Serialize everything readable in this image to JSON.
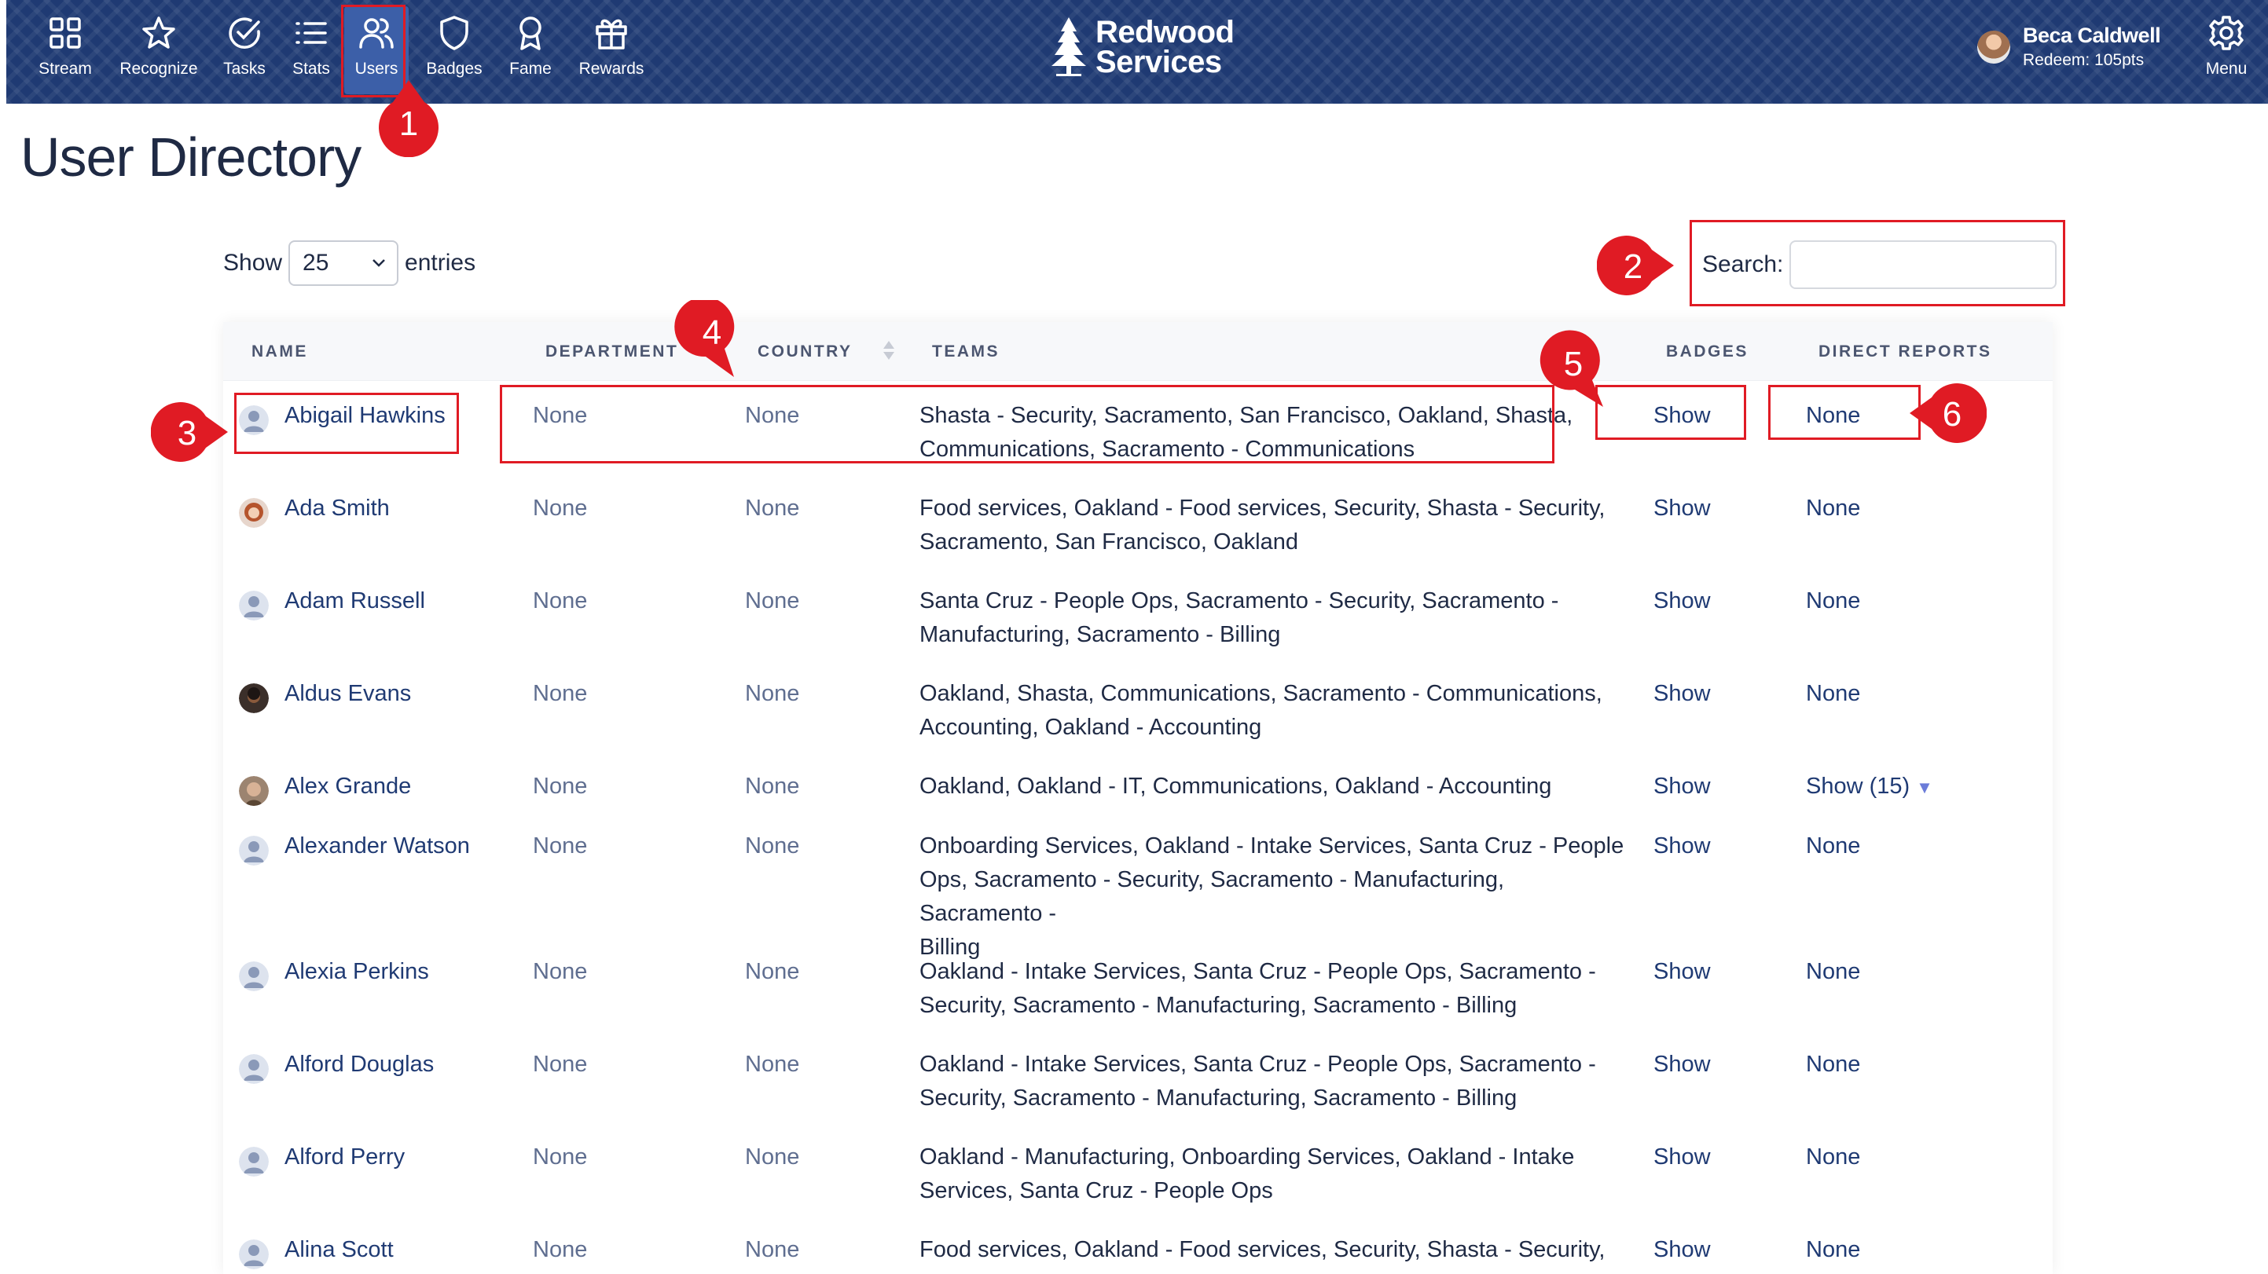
{
  "nav": {
    "items": [
      {
        "label": "Stream",
        "icon": "grid-icon"
      },
      {
        "label": "Recognize",
        "icon": "star-icon"
      },
      {
        "label": "Tasks",
        "icon": "check-circle-icon"
      },
      {
        "label": "Stats",
        "icon": "list-icon"
      },
      {
        "label": "Users",
        "icon": "users-icon",
        "active": true
      },
      {
        "label": "Badges",
        "icon": "shield-icon"
      },
      {
        "label": "Fame",
        "icon": "award-icon"
      },
      {
        "label": "Rewards",
        "icon": "gift-icon"
      }
    ],
    "brand_line1": "Redwood",
    "brand_line2": "Services",
    "user_name": "Beca Caldwell",
    "user_redeem": "Redeem: 105pts",
    "menu_label": "Menu"
  },
  "page": {
    "title": "User Directory",
    "show_label": "Show",
    "entries_value": "25",
    "entries_label": "entries",
    "search_label": "Search:",
    "search_value": ""
  },
  "table": {
    "columns": [
      "NAME",
      "DEPARTMENT",
      "COUNTRY",
      "TEAMS",
      "BADGES",
      "DIRECT REPORTS"
    ],
    "rows": [
      {
        "name": "Abigail Hawkins",
        "avatar": "default",
        "department": "None",
        "country": "None",
        "teams_l1": "Shasta - Security, Sacramento, San Francisco, Oakland, Shasta,",
        "teams_l2": "Communications, Sacramento - Communications",
        "teams_l3": "",
        "badges": "Show",
        "reports": "None"
      },
      {
        "name": "Ada Smith",
        "avatar": "photo-redhair",
        "department": "None",
        "country": "None",
        "teams_l1": "Food services, Oakland - Food services, Security, Shasta - Security,",
        "teams_l2": "Sacramento, San Francisco, Oakland",
        "teams_l3": "",
        "badges": "Show",
        "reports": "None"
      },
      {
        "name": "Adam Russell",
        "avatar": "default",
        "department": "None",
        "country": "None",
        "teams_l1": "Santa Cruz - People Ops, Sacramento - Security, Sacramento -",
        "teams_l2": "Manufacturing, Sacramento - Billing",
        "teams_l3": "",
        "badges": "Show",
        "reports": "None"
      },
      {
        "name": "Aldus Evans",
        "avatar": "photo-dark",
        "department": "None",
        "country": "None",
        "teams_l1": "Oakland, Shasta, Communications, Sacramento - Communications,",
        "teams_l2": "Accounting, Oakland - Accounting",
        "teams_l3": "",
        "badges": "Show",
        "reports": "None"
      },
      {
        "name": "Alex Grande",
        "avatar": "photo-brown",
        "department": "None",
        "country": "None",
        "teams_l1": "Oakland, Oakland - IT, Communications, Oakland - Accounting",
        "teams_l2": "",
        "teams_l3": "",
        "badges": "Show",
        "reports": "Show (15)"
      },
      {
        "name": "Alexander Watson",
        "avatar": "default",
        "department": "None",
        "country": "None",
        "teams_l1": "Onboarding Services, Oakland - Intake Services, Santa Cruz - People",
        "teams_l2": "Ops, Sacramento - Security, Sacramento - Manufacturing, Sacramento -",
        "teams_l3": "Billing",
        "badges": "Show",
        "reports": "None"
      },
      {
        "name": "Alexia Perkins",
        "avatar": "default",
        "department": "None",
        "country": "None",
        "teams_l1": "Oakland - Intake Services, Santa Cruz - People Ops, Sacramento -",
        "teams_l2": "Security, Sacramento - Manufacturing, Sacramento - Billing",
        "teams_l3": "",
        "badges": "Show",
        "reports": "None"
      },
      {
        "name": "Alford Douglas",
        "avatar": "default",
        "department": "None",
        "country": "None",
        "teams_l1": "Oakland - Intake Services, Santa Cruz - People Ops, Sacramento -",
        "teams_l2": "Security, Sacramento - Manufacturing, Sacramento - Billing",
        "teams_l3": "",
        "badges": "Show",
        "reports": "None"
      },
      {
        "name": "Alford Perry",
        "avatar": "default",
        "department": "None",
        "country": "None",
        "teams_l1": "Oakland - Manufacturing, Onboarding Services, Oakland - Intake",
        "teams_l2": "Services, Santa Cruz - People Ops",
        "teams_l3": "",
        "badges": "Show",
        "reports": "None"
      },
      {
        "name": "Alina Scott",
        "avatar": "default",
        "department": "None",
        "country": "None",
        "teams_l1": "Food services, Oakland - Food services, Security, Shasta - Security,",
        "teams_l2": "",
        "teams_l3": "",
        "badges": "Show",
        "reports": "None"
      }
    ]
  },
  "annotations": {
    "color": "#e01b24",
    "markers": [
      "1",
      "2",
      "3",
      "4",
      "5",
      "6"
    ]
  }
}
